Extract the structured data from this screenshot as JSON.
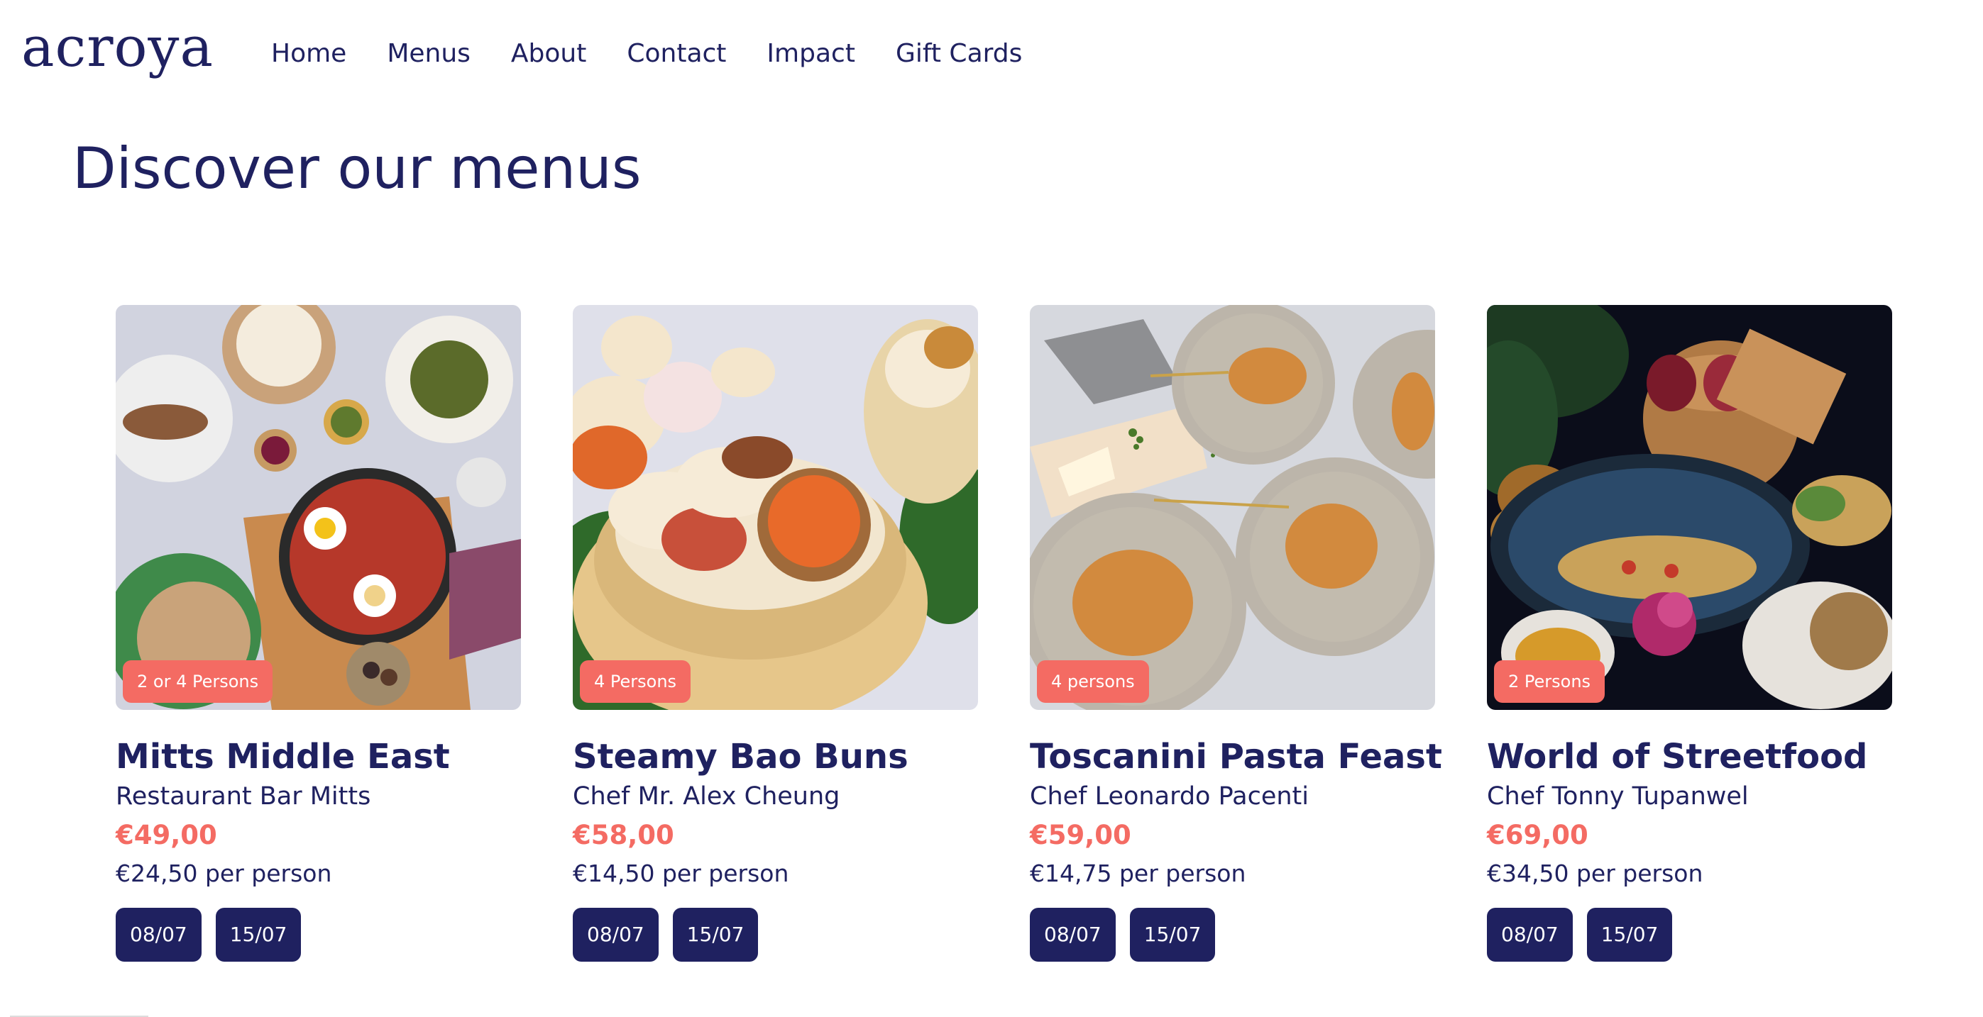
{
  "header": {
    "logo_text": "acroya",
    "nav": [
      "Home",
      "Menus",
      "About",
      "Contact",
      "Impact",
      "Gift Cards"
    ]
  },
  "page_title": "Discover our menus",
  "colors": {
    "navy": "#1f2160",
    "coral": "#f46b63",
    "white": "#ffffff"
  },
  "cards": [
    {
      "persons": "2 or 4 Persons",
      "title": "Mitts Middle East",
      "chef": "Restaurant Bar Mitts",
      "price": "€49,00",
      "per_person": "€24,50 per person",
      "dates": [
        "08/07",
        "15/07"
      ],
      "image_theme": "middle-east-spread"
    },
    {
      "persons": "4 Persons",
      "title": "Steamy Bao Buns",
      "chef": "Chef Mr. Alex Cheung",
      "price": "€58,00",
      "per_person": "€14,50 per person",
      "dates": [
        "08/07",
        "15/07"
      ],
      "image_theme": "bao-buns-steamer"
    },
    {
      "persons": "4 persons",
      "title": "Toscanini Pasta Feast",
      "chef": "Chef Leonardo Pacenti",
      "price": "€59,00",
      "per_person": "€14,75 per person",
      "dates": [
        "08/07",
        "15/07"
      ],
      "image_theme": "pasta-plates"
    },
    {
      "persons": "2 Persons",
      "title": "World of Streetfood",
      "chef": "Chef Tonny Tupanwel",
      "price": "€69,00",
      "per_person": "€34,50 per person",
      "dates": [
        "08/07",
        "15/07"
      ],
      "image_theme": "streetfood-dark"
    }
  ]
}
